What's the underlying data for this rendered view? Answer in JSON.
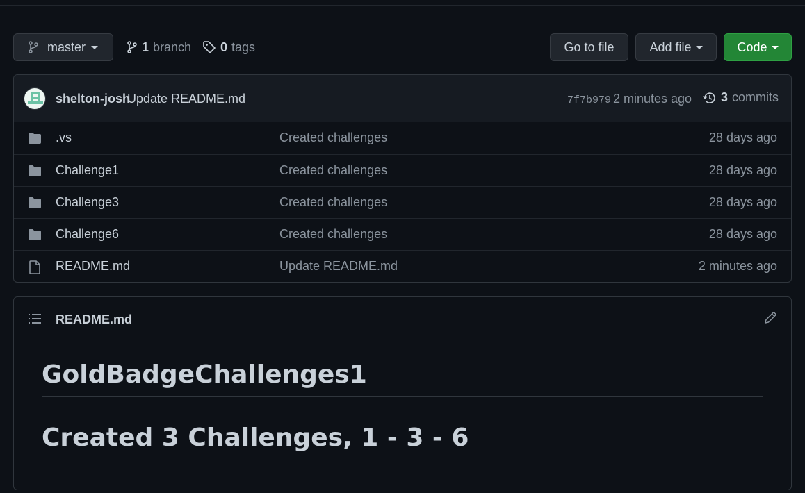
{
  "toolbar": {
    "branch_label": "master",
    "branches_count": "1",
    "branches_label": "branch",
    "tags_count": "0",
    "tags_label": "tags",
    "goto_label": "Go to file",
    "addfile_label": "Add file",
    "code_label": "Code"
  },
  "commit": {
    "author": "shelton-josh",
    "message": "Update README.md",
    "sha": "7f7b979",
    "time": "2 minutes ago",
    "commits_count": "3",
    "commits_label": "commits"
  },
  "files": [
    {
      "type": "folder",
      "name": ".vs",
      "message": "Created challenges",
      "age": "28 days ago"
    },
    {
      "type": "folder",
      "name": "Challenge1",
      "message": "Created challenges",
      "age": "28 days ago"
    },
    {
      "type": "folder",
      "name": "Challenge3",
      "message": "Created challenges",
      "age": "28 days ago"
    },
    {
      "type": "folder",
      "name": "Challenge6",
      "message": "Created challenges",
      "age": "28 days ago"
    },
    {
      "type": "file",
      "name": "README.md",
      "message": "Update README.md",
      "age": "2 minutes ago"
    }
  ],
  "readme": {
    "title": "README.md",
    "heading1": "GoldBadgeChallenges1",
    "heading2": "Created 3 Challenges, 1 - 3 - 6"
  },
  "colors": {
    "background": "#0d1117",
    "code_button": "#238636",
    "icon": "#8b949e"
  }
}
